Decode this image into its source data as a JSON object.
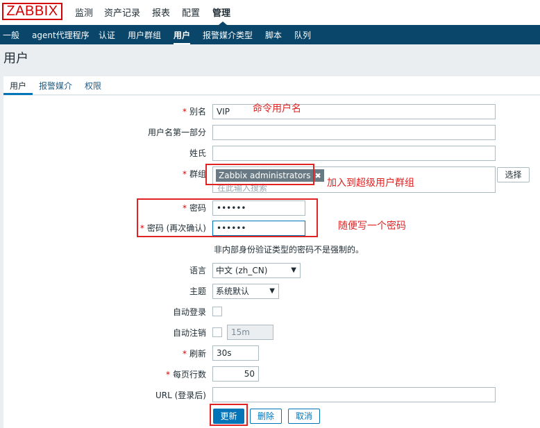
{
  "app": {
    "logo": "ZABBIX"
  },
  "mainnav": [
    {
      "label": "监测"
    },
    {
      "label": "资产记录"
    },
    {
      "label": "报表"
    },
    {
      "label": "配置"
    },
    {
      "label": "管理"
    }
  ],
  "subnav": [
    {
      "label": "一般"
    },
    {
      "label": "agent代理程序"
    },
    {
      "label": "认证"
    },
    {
      "label": "用户群组"
    },
    {
      "label": "用户"
    },
    {
      "label": "报警媒介类型"
    },
    {
      "label": "脚本"
    },
    {
      "label": "队列"
    }
  ],
  "page": {
    "title": "用户"
  },
  "tabs": [
    {
      "label": "用户"
    },
    {
      "label": "报警媒介"
    },
    {
      "label": "权限"
    }
  ],
  "form": {
    "alias": {
      "label": "别名",
      "value": "VIP"
    },
    "name": {
      "label": "用户名第一部分",
      "value": ""
    },
    "surname": {
      "label": "姓氏",
      "value": ""
    },
    "groups": {
      "label": "群组",
      "chip": "Zabbix administrators",
      "chip_remove": "✖",
      "placeholder": "在此输入搜索",
      "select_button": "选择"
    },
    "password": {
      "label": "密码",
      "value": "••••••"
    },
    "password2": {
      "label": "密码 (再次确认)",
      "value": "••••••"
    },
    "password_note": "非内部身份验证类型的密码不是强制的。",
    "language": {
      "label": "语言",
      "value": "中文 (zh_CN)"
    },
    "theme": {
      "label": "主题",
      "value": "系统默认"
    },
    "autologin": {
      "label": "自动登录"
    },
    "autologout": {
      "label": "自动注销",
      "value": "15m"
    },
    "refresh": {
      "label": "刷新",
      "value": "30s"
    },
    "rows_per_page": {
      "label": "每页行数",
      "value": "50"
    },
    "url": {
      "label": "URL (登录后)",
      "value": ""
    },
    "required_mark": "*",
    "dropdown_arrow": "▼"
  },
  "buttons": {
    "update": "更新",
    "delete": "删除",
    "cancel": "取消"
  },
  "annotations": {
    "alias_note": "命令用户名",
    "group_note": "加入到超级用户群组",
    "password_note": "随便写一个密码"
  },
  "colors": {
    "brand": "#d40000",
    "nav": "#0a466a",
    "accent": "#0275b8",
    "annotation": "#e02222"
  }
}
